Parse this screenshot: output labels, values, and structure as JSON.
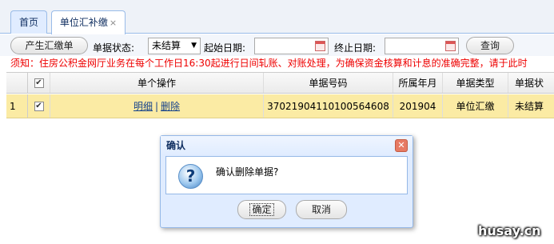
{
  "tabs": [
    {
      "label": "首页"
    },
    {
      "label": "单位汇补缴",
      "close": "×"
    }
  ],
  "toolbar": {
    "generate_button": "产生汇缴单",
    "status_label": "单据状态:",
    "status_value": "未结算",
    "status_arrow": "▼",
    "start_date_label": "起始日期:",
    "start_date_value": "",
    "end_date_label": "终止日期:",
    "end_date_value": "",
    "query_button": "查询"
  },
  "notice": "须知：住房公积金网厅业务在每个工作日16:30起进行日间轧账、对账处理，为确保资金核算和计息的准确完整，请于此时",
  "grid": {
    "columns": [
      "",
      "",
      "单个操作",
      "单据号码",
      "所属年月",
      "单据类型",
      "单据状"
    ],
    "rows": [
      {
        "index": "1",
        "checked": "✔",
        "op_detail": "明细",
        "op_sep": "|",
        "op_delete": "删除",
        "doc_no": "37021904110100564608",
        "period": "201904",
        "doc_type": "单位汇缴",
        "doc_status": "未结算"
      }
    ],
    "header_check": "✔"
  },
  "dialog": {
    "title": "确认",
    "close": "✕",
    "icon": "question-icon",
    "icon_glyph": "?",
    "message": "确认删除单据?",
    "ok_button": "确定",
    "cancel_button": "取消"
  },
  "watermark": "husay.cn"
}
